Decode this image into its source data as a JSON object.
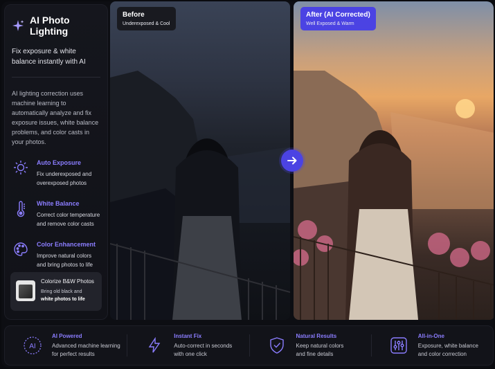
{
  "sidebar": {
    "title": "AI Photo Lighting",
    "tagline": "Fix exposure & white balance instantly with AI",
    "description": "AI lighting correction uses machine learning to automatically analyze and fix exposure issues, white balance problems, and color casts in your photos.",
    "features": [
      {
        "title": "Auto Exposure",
        "text": "Fix underexposed and overexposed photos",
        "icon": "sun-icon"
      },
      {
        "title": "White Balance",
        "text": "Correct color temperature and remove color casts",
        "icon": "thermometer-icon"
      },
      {
        "title": "Color Enhancement",
        "text": "Improve natural colors and bring photos to life",
        "icon": "palette-icon"
      }
    ],
    "colorize": {
      "title": "Colorize B&W Photos",
      "text_pre": "Bring",
      "text_mid": "old black and",
      "text_bold": "white photos to life"
    }
  },
  "before": {
    "title": "Before",
    "subtitle": "Underexposed & Cool"
  },
  "after": {
    "title": "After (AI Corrected)",
    "subtitle": "Well Exposed & Warm"
  },
  "bottom": [
    {
      "title": "AI Powered",
      "text1": "Advanced machine learning",
      "text2": "for perfect results",
      "icon": "ai-icon"
    },
    {
      "title": "Instant Fix",
      "text1": "Auto-correct in seconds",
      "text2": "with one click",
      "icon": "lightning-icon"
    },
    {
      "title": "Natural Results",
      "text1": "Keep natural colors",
      "text2": "and fine details",
      "icon": "shield-check-icon"
    },
    {
      "title": "All-in-One",
      "text1": "Exposure, white balance",
      "text2": "and color correction",
      "icon": "sliders-icon"
    }
  ],
  "colors": {
    "accent": "#8b7dff",
    "button": "#4b43e3"
  }
}
